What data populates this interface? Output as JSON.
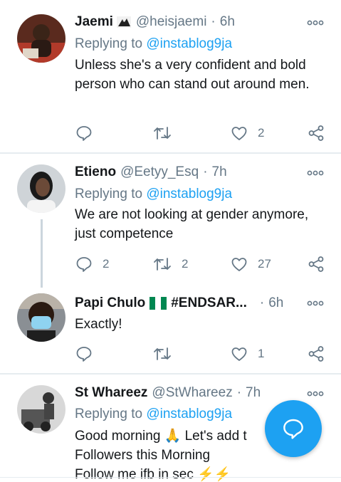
{
  "tweets": [
    {
      "name": "Jaemi",
      "handle": "@heisjaemi",
      "time": "6h",
      "replying_prefix": "Replying to",
      "replying_to": "@instablog9ja",
      "body": "Unless she's a very confident and bold person who can stand out around men.",
      "replies": "",
      "retweets": "",
      "likes": "2"
    },
    {
      "name": "Etieno",
      "handle": "@Eetyy_Esq",
      "time": "7h",
      "replying_prefix": "Replying to",
      "replying_to": "@instablog9ja",
      "body": "We are not looking at gender anymore, just competence",
      "replies": "2",
      "retweets": "2",
      "likes": "27"
    },
    {
      "name": "Papi Chulo",
      "name_suffix": "#ENDSAR...",
      "time": "6h",
      "body": "Exactly!",
      "replies": "",
      "retweets": "",
      "likes": "1"
    },
    {
      "name": "St Whareez",
      "handle": "@StWhareez",
      "time": "7h",
      "replying_prefix": "Replying to",
      "replying_to": "@instablog9ja",
      "body_line1": "Good morning 🙏 Let's add t",
      "body_line2": "Followers this Morning",
      "body_line3": "Follow me ifb in sec ⚡⚡"
    }
  ],
  "dot": "·",
  "icons": {
    "more": "more-dots-icon",
    "reply": "reply-icon",
    "retweet": "retweet-icon",
    "like": "heart-icon",
    "share": "share-icon",
    "compose": "compose-reply-icon",
    "flag": "nigeria-flag-icon"
  },
  "colors": {
    "accent": "#1da1f2",
    "secondary_text": "#657786",
    "separator": "#e6ecf0",
    "flag_green": "#008751"
  }
}
